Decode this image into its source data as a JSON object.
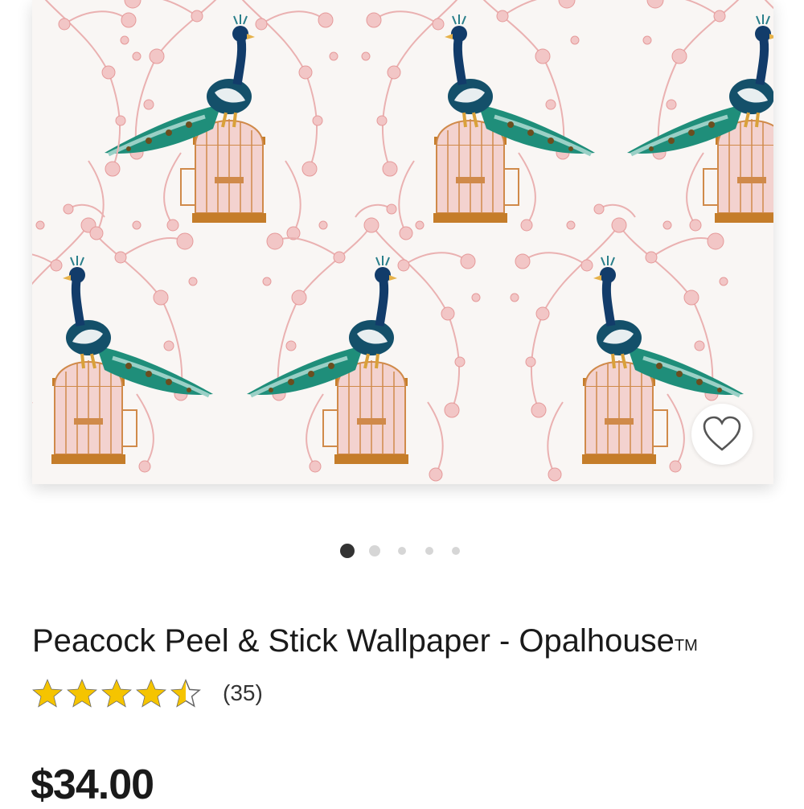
{
  "product": {
    "title": "Peacock Peel & Stick Wallpaper - Opalhouse",
    "trademark": "TM",
    "rating_value": 4.5,
    "rating_max": 5,
    "review_count": "(35)",
    "price": "$34.00"
  },
  "carousel": {
    "total": 5,
    "active": 1
  },
  "colors": {
    "star": "#f5c400",
    "price": "#1a1a1a",
    "active_dot": "#333333",
    "inactive_dot": "#d6d6d6"
  },
  "icons": {
    "favorite": "heart-outline-icon",
    "rating": "star-icon"
  }
}
